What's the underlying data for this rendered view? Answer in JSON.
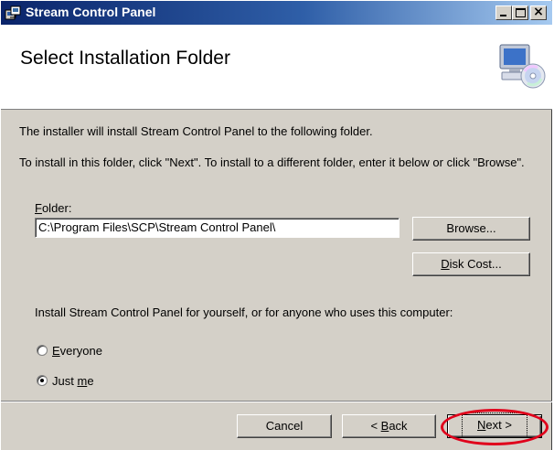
{
  "window": {
    "title": "Stream Control Panel"
  },
  "header": {
    "title": "Select Installation Folder",
    "icon": "computer-cd-icon"
  },
  "body": {
    "line1": "The installer will install Stream Control Panel to the following folder.",
    "line2": "To install in this folder, click \"Next\". To install to a different folder, enter it below or click \"Browse\".",
    "folder_label_first": "F",
    "folder_label_rest": "older:",
    "folder_value": "C:\\Program Files\\SCP\\Stream Control Panel\\",
    "browse_label": "Browse...",
    "disk_cost_label_first": "D",
    "disk_cost_label_rest": "isk Cost...",
    "install_for_label": "Install Stream Control Panel for yourself, or for anyone who uses this computer:",
    "everyone_first": "E",
    "everyone_rest": "veryone",
    "justme_pre": "Just ",
    "justme_u": "m",
    "justme_post": "e",
    "selected_option": "Just me"
  },
  "buttons": {
    "cancel": "Cancel",
    "back_pre": "< ",
    "back_u": "B",
    "back_rest": "ack",
    "next_u": "N",
    "next_rest": "ext >"
  },
  "colors": {
    "titlebar_start": "#0a246a",
    "titlebar_end": "#a6caf0",
    "dialog_face": "#d4d0c8",
    "highlight_ring": "#e0001b"
  }
}
